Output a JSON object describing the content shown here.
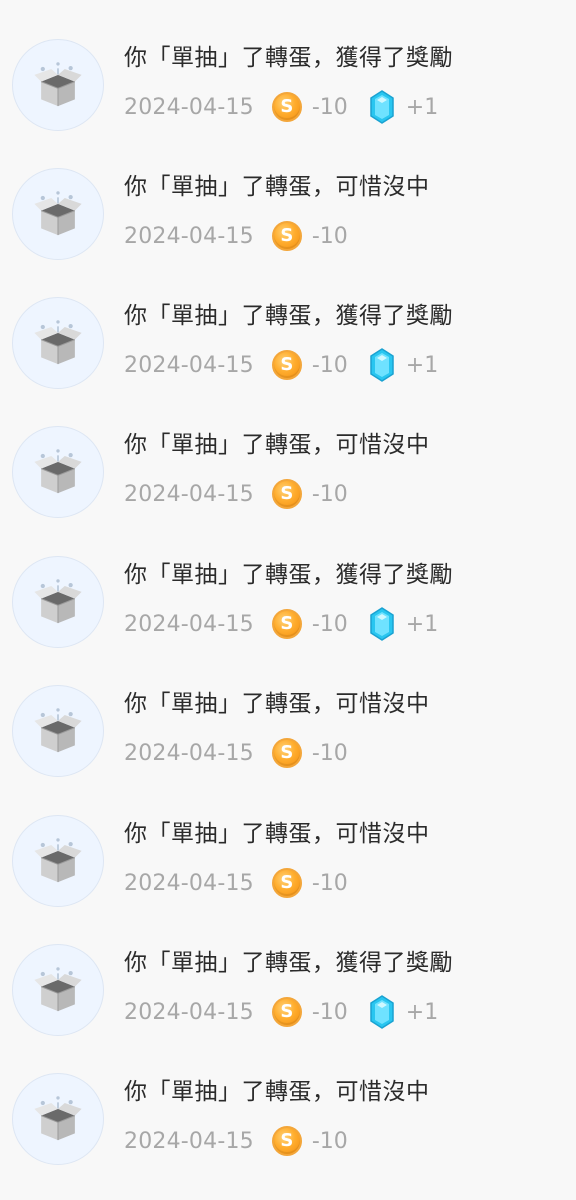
{
  "colors": {
    "background": "#f8f8f8",
    "avatar_bg": "#eef5ff",
    "coin": "#ffad2e",
    "gem": "#29c6f0",
    "muted_text": "#a7a7a7",
    "text": "#2b2b2b"
  },
  "icons": {
    "avatar": "open-box-icon",
    "coin": "coin-icon",
    "gem": "gem-icon"
  },
  "rows": [
    {
      "title": "你「單抽」了轉蛋，獲得了獎勵",
      "date": "2024-04-15",
      "coin_glyph": "S",
      "coin_delta": "-10",
      "gem_delta": "+1",
      "has_gem": true
    },
    {
      "title": "你「單抽」了轉蛋，可惜沒中",
      "date": "2024-04-15",
      "coin_glyph": "S",
      "coin_delta": "-10",
      "gem_delta": "",
      "has_gem": false
    },
    {
      "title": "你「單抽」了轉蛋，獲得了獎勵",
      "date": "2024-04-15",
      "coin_glyph": "S",
      "coin_delta": "-10",
      "gem_delta": "+1",
      "has_gem": true
    },
    {
      "title": "你「單抽」了轉蛋，可惜沒中",
      "date": "2024-04-15",
      "coin_glyph": "S",
      "coin_delta": "-10",
      "gem_delta": "",
      "has_gem": false
    },
    {
      "title": "你「單抽」了轉蛋，獲得了獎勵",
      "date": "2024-04-15",
      "coin_glyph": "S",
      "coin_delta": "-10",
      "gem_delta": "+1",
      "has_gem": true
    },
    {
      "title": "你「單抽」了轉蛋，可惜沒中",
      "date": "2024-04-15",
      "coin_glyph": "S",
      "coin_delta": "-10",
      "gem_delta": "",
      "has_gem": false
    },
    {
      "title": "你「單抽」了轉蛋，可惜沒中",
      "date": "2024-04-15",
      "coin_glyph": "S",
      "coin_delta": "-10",
      "gem_delta": "",
      "has_gem": false
    },
    {
      "title": "你「單抽」了轉蛋，獲得了獎勵",
      "date": "2024-04-15",
      "coin_glyph": "S",
      "coin_delta": "-10",
      "gem_delta": "+1",
      "has_gem": true
    },
    {
      "title": "你「單抽」了轉蛋，可惜沒中",
      "date": "2024-04-15",
      "coin_glyph": "S",
      "coin_delta": "-10",
      "gem_delta": "",
      "has_gem": false
    }
  ]
}
